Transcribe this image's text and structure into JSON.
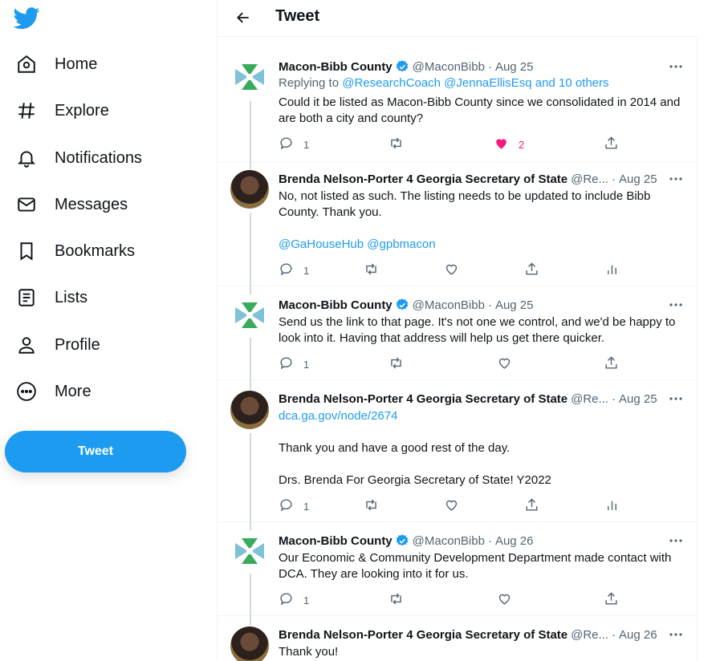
{
  "colors": {
    "accent": "#1d9bf0",
    "like": "#f91880",
    "secondary_text": "#536471"
  },
  "sidebar": {
    "logo": "twitter-bird-icon",
    "items": [
      {
        "label": "Home",
        "icon": "home-icon"
      },
      {
        "label": "Explore",
        "icon": "hashtag-icon"
      },
      {
        "label": "Notifications",
        "icon": "bell-icon"
      },
      {
        "label": "Messages",
        "icon": "mail-icon"
      },
      {
        "label": "Bookmarks",
        "icon": "bookmark-icon"
      },
      {
        "label": "Lists",
        "icon": "list-icon"
      },
      {
        "label": "Profile",
        "icon": "person-icon"
      },
      {
        "label": "More",
        "icon": "more-circle-icon"
      }
    ],
    "tweet_button": "Tweet"
  },
  "header": {
    "title": "Tweet"
  },
  "tweets": [
    {
      "name": "Macon-Bibb County",
      "verified": true,
      "handle": "@MaconBibb",
      "date": "Aug 25",
      "replying_label": "Replying to",
      "replying_to": "@ResearchCoach @JennaEllisEsq and 10 others",
      "text": "Could it be listed as Macon-Bibb County since we consolidated in 2014 and are both a city and county?",
      "replies": "1",
      "likes": "2",
      "liked": true
    },
    {
      "name": "Brenda Nelson-Porter 4 Georgia Secretary of State",
      "verified": false,
      "handle": "@Re...",
      "date": "Aug 25",
      "text": "No, not listed as such. The listing needs to be updated to include Bibb County. Thank you.",
      "mentions": "@GaHouseHub @gpbmacon",
      "replies": "1"
    },
    {
      "name": "Macon-Bibb County",
      "verified": true,
      "handle": "@MaconBibb",
      "date": "Aug 25",
      "text": "Send us the link to that page. It's not one we control, and we'd be happy to look into it. Having that address will help us get there quicker.",
      "replies": "1"
    },
    {
      "name": "Brenda Nelson-Porter 4 Georgia Secretary of State",
      "verified": false,
      "handle": "@Re...",
      "date": "Aug 25",
      "link": "dca.ga.gov/node/2674",
      "text": "Thank you and have a good rest of the day.",
      "text2": "Drs. Brenda For Georgia Secretary of State! Y2022",
      "replies": "1"
    },
    {
      "name": "Macon-Bibb County",
      "verified": true,
      "handle": "@MaconBibb",
      "date": "Aug 26",
      "text": "Our Economic & Community Development Department made contact with DCA. They are looking into it for us.",
      "replies": "1"
    },
    {
      "name": "Brenda Nelson-Porter 4 Georgia Secretary of State",
      "verified": false,
      "handle": "@Re...",
      "date": "Aug 26",
      "text": "Thank you!"
    }
  ]
}
